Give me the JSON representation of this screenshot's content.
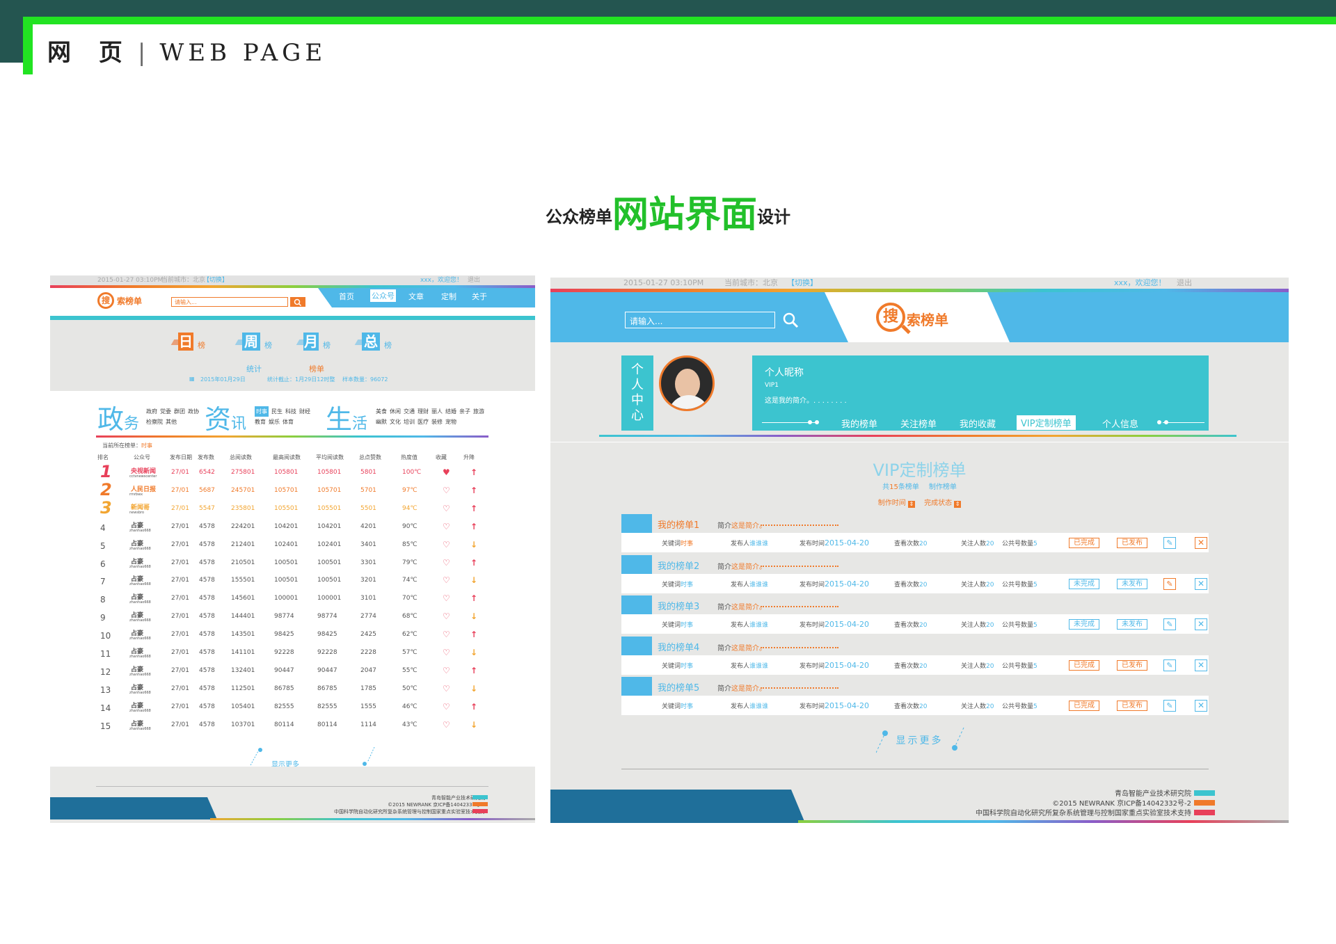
{
  "header": {
    "cn": "网 页",
    "en": "WEB PAGE",
    "sep": "|"
  },
  "title": {
    "pre": "公众榜单",
    "big": "网站界面",
    "post": "设计"
  },
  "left": {
    "topbar": {
      "datetime": "2015-01-27 03:10PM",
      "city": "当前城市：北京",
      "switch": "【切换】",
      "greet": "xxx，欢迎您！",
      "logout": "退出"
    },
    "logo": {
      "char": "搜",
      "text": "索榜单"
    },
    "search_placeholder": "请输入...",
    "nav": [
      "首页",
      "公众号",
      "文章",
      "定制",
      "关于"
    ],
    "banner": {
      "tabs": [
        {
          "ch": "日",
          "lbl": "榜"
        },
        {
          "ch": "周",
          "lbl": "榜"
        },
        {
          "ch": "月",
          "lbl": "榜"
        },
        {
          "ch": "总",
          "lbl": "榜"
        }
      ],
      "stat": "统计",
      "list": "榜单",
      "date": "2015年01月29日",
      "deadline": "统计截止：1月29日12时整",
      "sample": "样本数量：96072"
    },
    "cats": [
      {
        "big": "政",
        "small": "务",
        "tags": [
          "政府",
          "党委",
          "群团",
          "政协",
          "检察院",
          "其他"
        ]
      },
      {
        "big": "资",
        "small": "讯",
        "tags": [
          "时事",
          "民生",
          "科技",
          "财经",
          "教育",
          "娱乐",
          "体育"
        ]
      },
      {
        "big": "生",
        "small": "活",
        "tags": [
          "美食",
          "休闲",
          "交通",
          "理财",
          "丽人",
          "结婚",
          "亲子",
          "旅游",
          "幽默",
          "文化",
          "培训",
          "医疗",
          "装修",
          "宠物"
        ]
      }
    ],
    "current": "当前所在榜单：",
    "current_val": "时事",
    "columns": [
      "排名",
      "公众号",
      "发布日期",
      "发布数",
      "总阅读数",
      "最高阅读数",
      "平均阅读数",
      "总点赞数",
      "热度值",
      "收藏",
      "升降"
    ],
    "rows": [
      {
        "rank": "1",
        "name": "央视新闻",
        "sub": "cctvnewscenter",
        "date": "27/01",
        "n": "6542",
        "total": "275801",
        "max": "105801",
        "avg": "105801",
        "like": "5801",
        "heat": "100℃",
        "fav": "filled",
        "trend": "up"
      },
      {
        "rank": "2",
        "name": "人民日报",
        "sub": "rmrbwx",
        "date": "27/01",
        "n": "5687",
        "total": "245701",
        "max": "105701",
        "avg": "105701",
        "like": "5701",
        "heat": "97℃",
        "fav": "empty",
        "trend": "up"
      },
      {
        "rank": "3",
        "name": "新闻哥",
        "sub": "newsbro",
        "date": "27/01",
        "n": "5547",
        "total": "235801",
        "max": "105501",
        "avg": "105501",
        "like": "5501",
        "heat": "94℃",
        "fav": "empty",
        "trend": "up"
      },
      {
        "rank": "4",
        "name": "占豪",
        "sub": "zhanhao668",
        "date": "27/01",
        "n": "4578",
        "total": "224201",
        "max": "104201",
        "avg": "104201",
        "like": "4201",
        "heat": "90℃",
        "fav": "empty",
        "trend": "up"
      },
      {
        "rank": "5",
        "name": "占豪",
        "sub": "zhanhao668",
        "date": "27/01",
        "n": "4578",
        "total": "212401",
        "max": "102401",
        "avg": "102401",
        "like": "3401",
        "heat": "85℃",
        "fav": "empty",
        "trend": "down"
      },
      {
        "rank": "6",
        "name": "占豪",
        "sub": "zhanhao668",
        "date": "27/01",
        "n": "4578",
        "total": "210501",
        "max": "100501",
        "avg": "100501",
        "like": "3301",
        "heat": "79℃",
        "fav": "empty",
        "trend": "up"
      },
      {
        "rank": "7",
        "name": "占豪",
        "sub": "zhanhao668",
        "date": "27/01",
        "n": "4578",
        "total": "155501",
        "max": "100501",
        "avg": "100501",
        "like": "3201",
        "heat": "74℃",
        "fav": "empty",
        "trend": "down"
      },
      {
        "rank": "8",
        "name": "占豪",
        "sub": "zhanhao668",
        "date": "27/01",
        "n": "4578",
        "total": "145601",
        "max": "100001",
        "avg": "100001",
        "like": "3101",
        "heat": "70℃",
        "fav": "empty",
        "trend": "up"
      },
      {
        "rank": "9",
        "name": "占豪",
        "sub": "zhanhao668",
        "date": "27/01",
        "n": "4578",
        "total": "144401",
        "max": "98774",
        "avg": "98774",
        "like": "2774",
        "heat": "68℃",
        "fav": "empty",
        "trend": "down"
      },
      {
        "rank": "10",
        "name": "占豪",
        "sub": "zhanhao668",
        "date": "27/01",
        "n": "4578",
        "total": "143501",
        "max": "98425",
        "avg": "98425",
        "like": "2425",
        "heat": "62℃",
        "fav": "empty",
        "trend": "up"
      },
      {
        "rank": "11",
        "name": "占豪",
        "sub": "zhanhao668",
        "date": "27/01",
        "n": "4578",
        "total": "141101",
        "max": "92228",
        "avg": "92228",
        "like": "2228",
        "heat": "57℃",
        "fav": "empty",
        "trend": "down"
      },
      {
        "rank": "12",
        "name": "占豪",
        "sub": "zhanhao668",
        "date": "27/01",
        "n": "4578",
        "total": "132401",
        "max": "90447",
        "avg": "90447",
        "like": "2047",
        "heat": "55℃",
        "fav": "empty",
        "trend": "up"
      },
      {
        "rank": "13",
        "name": "占豪",
        "sub": "zhanhao668",
        "date": "27/01",
        "n": "4578",
        "total": "112501",
        "max": "86785",
        "avg": "86785",
        "like": "1785",
        "heat": "50℃",
        "fav": "empty",
        "trend": "down"
      },
      {
        "rank": "14",
        "name": "占豪",
        "sub": "zhanhao668",
        "date": "27/01",
        "n": "4578",
        "total": "105401",
        "max": "82555",
        "avg": "82555",
        "like": "1555",
        "heat": "46℃",
        "fav": "empty",
        "trend": "up"
      },
      {
        "rank": "15",
        "name": "占豪",
        "sub": "zhanhao668",
        "date": "27/01",
        "n": "4578",
        "total": "103701",
        "max": "80114",
        "avg": "80114",
        "like": "1114",
        "heat": "43℃",
        "fav": "empty",
        "trend": "down"
      }
    ],
    "more": "显示更多",
    "footer": [
      "青岛智能产业技术研究院",
      "©2015 NEWRANK 京ICP备14042332号-2",
      "中国科学院自动化研究所复杂系统管理与控制国家重点实验室技术支持"
    ]
  },
  "right": {
    "topbar": {
      "datetime": "2015-01-27 03:10PM",
      "city": "当前城市：北京",
      "switch": "【切换】",
      "greet": "xxx，欢迎您！",
      "logout": "退出"
    },
    "search_placeholder": "请输入...",
    "logo": {
      "char": "搜",
      "text": "索榜单"
    },
    "side_label": "个人中心",
    "profile": {
      "nick": "个人昵称",
      "level": "VIP1",
      "intro": "这是我的简介。. . . . . . . ."
    },
    "tabs": [
      "我的榜单",
      "关注榜单",
      "我的收藏",
      "VIP定制榜单",
      "个人信息"
    ],
    "section": {
      "title": "VIP定制榜单",
      "count_pre": "共",
      "count": "15",
      "count_post": "条榜单",
      "make": "制作榜单",
      "time": "制作时间",
      "status": "完成状态"
    },
    "lists": [
      {
        "name": "我的榜单1",
        "intro_l": "简介",
        "intro": "这是简介。",
        "kw_l": "关键词",
        "kw": "时事",
        "pub_l": "发布人",
        "pub": "谁谁谁",
        "time_l": "发布时间",
        "time": "2015-04-20",
        "view_l": "查看次数",
        "view": "20",
        "fol_l": "关注人数",
        "fol": "20",
        "acc_l": "公共号数量",
        "acc": "5",
        "s1": "已完成",
        "s2": "已发布",
        "done": true
      },
      {
        "name": "我的榜单2",
        "intro_l": "简介",
        "intro": "这是简介。",
        "kw_l": "关键词",
        "kw": "时事",
        "pub_l": "发布人",
        "pub": "谁谁谁",
        "time_l": "发布时间",
        "time": "2015-04-20",
        "view_l": "查看次数",
        "view": "20",
        "fol_l": "关注人数",
        "fol": "20",
        "acc_l": "公共号数量",
        "acc": "5",
        "s1": "未完成",
        "s2": "未发布",
        "done": false
      },
      {
        "name": "我的榜单3",
        "intro_l": "简介",
        "intro": "这是简介。",
        "kw_l": "关键词",
        "kw": "时事",
        "pub_l": "发布人",
        "pub": "谁谁谁",
        "time_l": "发布时间",
        "time": "2015-04-20",
        "view_l": "查看次数",
        "view": "20",
        "fol_l": "关注人数",
        "fol": "20",
        "acc_l": "公共号数量",
        "acc": "5",
        "s1": "未完成",
        "s2": "未发布",
        "done": false
      },
      {
        "name": "我的榜单4",
        "intro_l": "简介",
        "intro": "这是简介。",
        "kw_l": "关键词",
        "kw": "时事",
        "pub_l": "发布人",
        "pub": "谁谁谁",
        "time_l": "发布时间",
        "time": "2015-04-20",
        "view_l": "查看次数",
        "view": "20",
        "fol_l": "关注人数",
        "fol": "20",
        "acc_l": "公共号数量",
        "acc": "5",
        "s1": "已完成",
        "s2": "已发布",
        "done": true
      },
      {
        "name": "我的榜单5",
        "intro_l": "简介",
        "intro": "这是简介。",
        "kw_l": "关键词",
        "kw": "时事",
        "pub_l": "发布人",
        "pub": "谁谁谁",
        "time_l": "发布时间",
        "time": "2015-04-20",
        "view_l": "查看次数",
        "view": "20",
        "fol_l": "关注人数",
        "fol": "20",
        "acc_l": "公共号数量",
        "acc": "5",
        "s1": "已完成",
        "s2": "已发布",
        "done": true
      }
    ],
    "more": "显示更多",
    "footer": [
      "青岛智能产业技术研究院",
      "©2015 NEWRANK 京ICP备14042332号-2",
      "中国科学院自动化研究所复杂系统管理与控制国家重点实验室技术支持"
    ]
  },
  "colors": {
    "dark": "#245550",
    "green": "#22e322",
    "blue": "#4fb8e8",
    "cyan": "#3cc4cf",
    "orange": "#f07a2a",
    "red": "#e8405a",
    "gold": "#f2a531",
    "navy": "#1f6f9a"
  }
}
